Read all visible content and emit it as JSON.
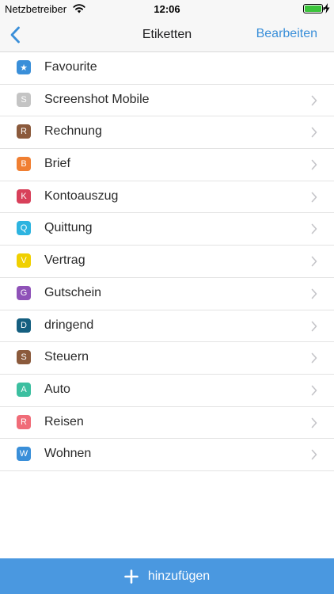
{
  "status": {
    "carrier": "Netzbetreiber",
    "time": "12:06"
  },
  "nav": {
    "title": "Etiketten",
    "edit_label": "Bearbeiten"
  },
  "labels": [
    {
      "letter": "★",
      "label": "Favourite",
      "color": "#3a8fd9",
      "chevron": false
    },
    {
      "letter": "S",
      "label": "Screenshot Mobile",
      "color": "#c4c4c4",
      "chevron": true
    },
    {
      "letter": "R",
      "label": "Rechnung",
      "color": "#8b5a3c",
      "chevron": true
    },
    {
      "letter": "B",
      "label": "Brief",
      "color": "#f07f32",
      "chevron": true
    },
    {
      "letter": "K",
      "label": "Kontoauszug",
      "color": "#d8405a",
      "chevron": true
    },
    {
      "letter": "Q",
      "label": "Quittung",
      "color": "#2db4e0",
      "chevron": true
    },
    {
      "letter": "V",
      "label": "Vertrag",
      "color": "#f0d000",
      "chevron": true
    },
    {
      "letter": "G",
      "label": "Gutschein",
      "color": "#8f52b8",
      "chevron": true
    },
    {
      "letter": "D",
      "label": "dringend",
      "color": "#155f80",
      "chevron": true
    },
    {
      "letter": "S",
      "label": "Steuern",
      "color": "#8b5a3c",
      "chevron": true
    },
    {
      "letter": "A",
      "label": "Auto",
      "color": "#3cbfa0",
      "chevron": true
    },
    {
      "letter": "R",
      "label": "Reisen",
      "color": "#f06c78",
      "chevron": true
    },
    {
      "letter": "W",
      "label": "Wohnen",
      "color": "#3a8fd9",
      "chevron": true
    }
  ],
  "footer": {
    "add_label": "hinzufügen"
  },
  "colors": {
    "accent": "#3a8fd9",
    "footer_bg": "#4a98e0"
  },
  "icons": {
    "back": "chevron-left-icon",
    "row": "chevron-right-icon",
    "add": "plus-icon",
    "status": [
      "wifi-icon",
      "battery-icon",
      "charging-icon"
    ]
  }
}
